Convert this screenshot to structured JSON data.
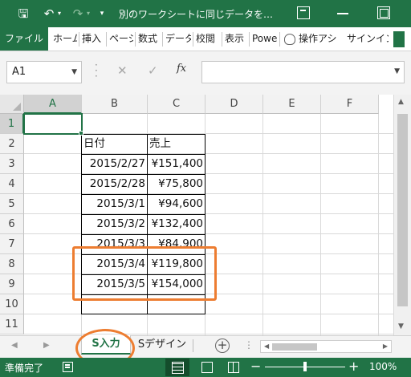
{
  "window": {
    "title": "別のワークシートに同じデータを…",
    "qat": {
      "save": "🖫",
      "undo": "↶",
      "redo": "↷",
      "dropdown": "▾",
      "customize": "▾"
    },
    "controls": {
      "options": "",
      "minimize": "",
      "maximize": ""
    }
  },
  "ribbon": {
    "tabs": [
      "ファイル",
      "ホーム",
      "挿入",
      "ページ",
      "数式",
      "データ",
      "校閲",
      "表示",
      "Powe",
      "操作アシ",
      "サインイン"
    ]
  },
  "formula_bar": {
    "name_box": "A1",
    "fx_label": "fx",
    "formula": ""
  },
  "grid": {
    "columns": [
      "A",
      "B",
      "C",
      "D",
      "E",
      "F"
    ],
    "rows": [
      "1",
      "2",
      "3",
      "4",
      "5",
      "6",
      "7",
      "8",
      "9",
      "10",
      "11"
    ],
    "active_cell": "A1",
    "table": {
      "headers": [
        "日付",
        "売上"
      ],
      "rows": [
        [
          "2015/2/27",
          "¥151,400"
        ],
        [
          "2015/2/28",
          "¥75,800"
        ],
        [
          "2015/3/1",
          "¥94,600"
        ],
        [
          "2015/3/2",
          "¥132,400"
        ],
        [
          "2015/3/3",
          "¥84,900"
        ],
        [
          "2015/3/4",
          "¥119,800"
        ],
        [
          "2015/3/5",
          "¥154,000"
        ]
      ]
    }
  },
  "sheets": {
    "tabs": [
      "S入力",
      "Sデザイン"
    ],
    "active": "S入力",
    "add": "+",
    "nav_prev": "◀",
    "nav_next": "▶",
    "more": "⋮"
  },
  "status_bar": {
    "status": "準備完了",
    "zoom": "100%",
    "zoom_minus": "−",
    "zoom_plus": "+"
  },
  "annotations": {
    "color": "#ed7d31",
    "rect_rows": [
      "8",
      "9"
    ],
    "ellipse_target": "S入力"
  },
  "colors": {
    "accent": "#217346",
    "annotation": "#ed7d31"
  }
}
